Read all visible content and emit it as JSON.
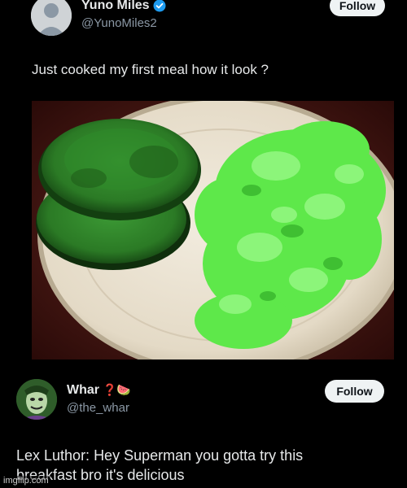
{
  "post1": {
    "display_name": "Yuno Miles",
    "handle": "@YunoMiles2",
    "follow_label": "Follow",
    "text": "Just cooked my first meal how it look ?"
  },
  "post2": {
    "display_name": "Whar",
    "name_emojis": "❓🍉",
    "handle": "@the_whar",
    "follow_label": "Follow",
    "text_line1": "Lex Luthor: Hey Superman you gotta try this",
    "text_line2": "breakfast bro it's delicious"
  },
  "watermark": "imgflip.com",
  "colors": {
    "background": "#000000",
    "text": "#e7e9ea",
    "secondary_text": "#8b98a5",
    "follow_bg": "#eff3f4",
    "verified": "#1d9bf0"
  }
}
